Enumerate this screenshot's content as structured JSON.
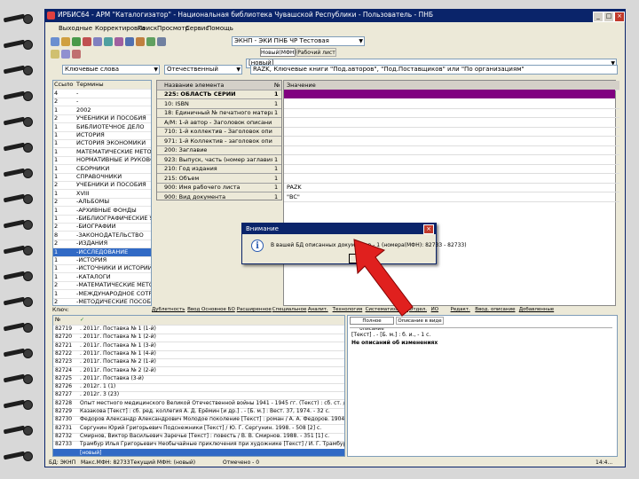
{
  "window": {
    "title": "ИРБИС64 - АРМ \"Каталогизатор\" - Национальная библиотека Чувашской Республики - Пользователь - ПНБ"
  },
  "menu": [
    "Выходные",
    "Корректировка",
    "Поиск",
    "Просмотр",
    "Сервис",
    "Помощь"
  ],
  "toolbar": {
    "db_selector": "ЭКНП - ЭКИ ПНБ ЧР Тестовая",
    "tab_new": "Новый(МФН)",
    "tab_work": "Рабочий лист",
    "format_field": "[новый]",
    "search_mode": "Ключевые слова",
    "search_field": "Отечественный",
    "query": "RAZK, Ключевые книги \"Под.авторов\", \"Под.Поставщиков\" или \"По организациям\""
  },
  "left_list": {
    "headers": [
      "Ссылок",
      "Термины"
    ],
    "rows": [
      {
        "n": "4",
        "t": "-"
      },
      {
        "n": "2",
        "t": "-"
      },
      {
        "n": "1",
        "t": "2002"
      },
      {
        "n": "2",
        "t": "УЧЕБНИКИ И ПОСОБИЯ"
      },
      {
        "n": "1",
        "t": "БИБЛИОТЕЧНОЕ ДЕЛО"
      },
      {
        "n": "1",
        "t": "ИСТОРИЯ"
      },
      {
        "n": "1",
        "t": "ИСТОРИЯ ЭКОНОМИКИ"
      },
      {
        "n": "1",
        "t": "МАТЕМАТИЧЕСКИЕ МЕТОДЫ"
      },
      {
        "n": "1",
        "t": "НОРМАТИВНЫЕ И РУКОВОД"
      },
      {
        "n": "1",
        "t": "СБОРНИКИ"
      },
      {
        "n": "1",
        "t": "СПРАВОЧНИКИ"
      },
      {
        "n": "2",
        "t": "УЧЕБНИКИ И ПОСОБИЯ"
      },
      {
        "n": "1",
        "t": "XVIII"
      },
      {
        "n": "2",
        "t": "-АЛЬБОМЫ"
      },
      {
        "n": "1",
        "t": "-АРХИВНЫЕ ФОНДЫ"
      },
      {
        "n": "1",
        "t": "-БИБЛИОГРАФИЧЕСКИЕ УК"
      },
      {
        "n": "2",
        "t": "-БИОГРАФИИ"
      },
      {
        "n": "8",
        "t": "-ЗАКОНОДАТЕЛЬСТВО"
      },
      {
        "n": "2",
        "t": "-ИЗДАНИЯ"
      },
      {
        "n": "1",
        "t": "-ИССЛЕДОВАНИЕ"
      },
      {
        "n": "1",
        "t": "-ИСТОРИЯ"
      },
      {
        "n": "1",
        "t": "-ИСТОЧНИКИ И ИСТОРИИ"
      },
      {
        "n": "1",
        "t": "-КАТАЛОГИ"
      },
      {
        "n": "2",
        "t": "-МАТЕМАТИЧЕСКИЕ МЕТОД"
      },
      {
        "n": "1",
        "t": "-МЕЖДУНАРОДНОЕ СОТРУ"
      },
      {
        "n": "2",
        "t": "-МЕТОДИЧЕСКИЕ ПОСОБИЯ"
      }
    ],
    "search_label": "Ключ:"
  },
  "field_grid": {
    "headers": [
      "Название элемента",
      "№"
    ],
    "rows": [
      {
        "name": "225: ОБЛАСТЬ СЕРИИ",
        "n": "1"
      },
      {
        "name": "10: ISBN",
        "n": "1"
      },
      {
        "name": "18: Единичный № печатного материала",
        "n": "1"
      },
      {
        "name": "А/М: 1-й автор - Заголовок описания",
        "n": ""
      },
      {
        "name": "710: 1-й коллектив - Заголовок описания",
        "n": ""
      },
      {
        "name": "971: 1-й Коллектив - заголовок описания",
        "n": ""
      },
      {
        "name": "200: Заглавие",
        "n": ""
      },
      {
        "name": "923: Выпуск, часть (номер заглавия)",
        "n": "1"
      },
      {
        "name": "210: Год издания",
        "n": "1"
      },
      {
        "name": "215: Объем",
        "n": "1"
      },
      {
        "name": "900: Имя рабочего листа",
        "n": "1"
      },
      {
        "name": "900: Вид документа",
        "n": "1"
      }
    ]
  },
  "value_panel": {
    "header": "Значение",
    "values": [
      "",
      "",
      "",
      "",
      "",
      "",
      "",
      "",
      "",
      "",
      "PAZK",
      "\"BC\""
    ]
  },
  "tabs": [
    "Дублетность",
    "Ввод Основное БО",
    "Расширенное",
    "Специальное",
    "Аналит.",
    "Технология",
    "Систематизация",
    "Отдел.",
    "ИО",
    "Редакт.",
    "Ввод. описание",
    "Добавленные"
  ],
  "records": {
    "headers": [
      "№",
      "✓"
    ],
    "rows": [
      {
        "n": "82719",
        "t": ". 2011г.  Поставка № 1 (1-й)"
      },
      {
        "n": "82720",
        "t": ". 2011г.  Поставка № 1 (2-й)"
      },
      {
        "n": "82721",
        "t": ". 2011г.  Поставка № 1 (3-й)"
      },
      {
        "n": "82722",
        "t": ". 2011г.  Поставка № 1 (4-й)"
      },
      {
        "n": "82723",
        "t": ". 2011г.  Поставка № 2 (1-й)"
      },
      {
        "n": "82724",
        "t": ". 2011г.  Поставка № 2 (2-й)"
      },
      {
        "n": "82725",
        "t": ". 2011г.  Поставка (3-й)"
      },
      {
        "n": "82726",
        "t": ". 2012г.  1 (1)"
      },
      {
        "n": "82727",
        "t": ". 2012г.  3 (23)"
      },
      {
        "n": "82728",
        "t": "Опыт местного медицинского Великой Отечественной войны 1941 - 1945 гг. (Текст) : сб. ст. / отв. ред. Е. И. Смирнов"
      },
      {
        "n": "82729",
        "t": "Казакова [Текст] : сб. ред. коллегия А. Д. Ерёмин [и др.] . - [Б. м.] : Вест. 37, 1974. - 32 с."
      },
      {
        "n": "82730",
        "t": "Федоров Александр Александрович Молодое поколение [Текст] : роман / А. А. Федоров. 1904. - 251 с. [24] с. ил."
      },
      {
        "n": "82731",
        "t": "Сергунин Юрий Григорьевич Подснежники [Текст] / Ю. Г. Сергунин. 1998. - 508 [2] с."
      },
      {
        "n": "82732",
        "t": "Смирнов, Виктор Васильевич Заречье [Текст] : повесть / В. В. Смирнов. 1988. - 351 [1] с."
      },
      {
        "n": "82733",
        "t": "Трамбур Илья Григорьевич Необычайные приключения при художнике [Текст] / И. Г. Трамбур. 1998. - 381 [1] с."
      },
      {
        "n": "",
        "t": "[новый]"
      }
    ]
  },
  "right_panel": {
    "tabs": [
      "Полное описание",
      "Описание в виде"
    ],
    "lines": [
      "[Текст] . - [Б. м.] : б. и., - 1 с.",
      "Не описаний об изменениях"
    ]
  },
  "status": {
    "db": "БД: ЭКНП",
    "mfn": "Макс.МФН: 82733",
    "current": "Текущий МФН: (новый)",
    "marked": "Отмечено - 0",
    "time": "14:4..."
  },
  "dialog": {
    "title": "Внимание",
    "message": "В вашей БД описанных документов - 1 (номера(МФН): 82733 - 82733)",
    "ok": "OK",
    "close": "×"
  },
  "colors": {
    "title_bar": "#0a246a",
    "selected": "#316ac5",
    "highlight": "#800080",
    "arrow": "#e0201e"
  }
}
